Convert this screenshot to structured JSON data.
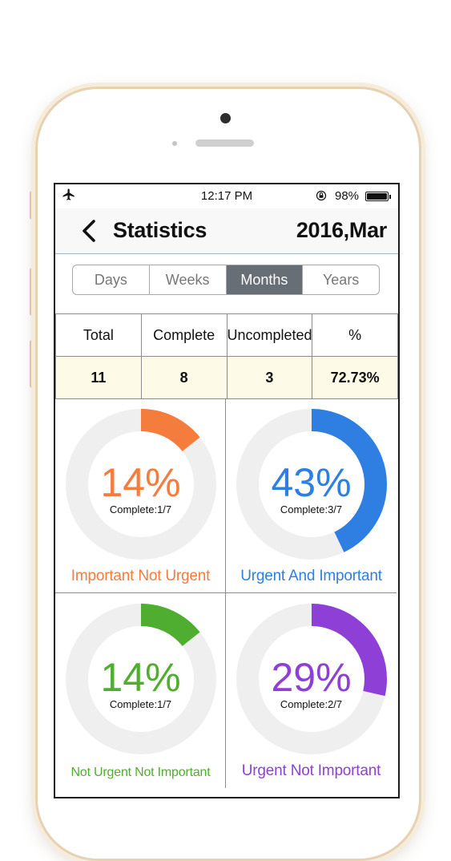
{
  "status_bar": {
    "time": "12:17 PM",
    "battery": "98%",
    "icons": [
      "airplane-icon",
      "orientation-lock-icon",
      "battery-icon"
    ]
  },
  "nav": {
    "back_icon": "chevron-left-icon",
    "title": "Statistics",
    "date": "2016,Mar"
  },
  "tabs": [
    {
      "label": "Days",
      "active": false
    },
    {
      "label": "Weeks",
      "active": false
    },
    {
      "label": "Months",
      "active": true
    },
    {
      "label": "Years",
      "active": false
    }
  ],
  "summary": {
    "headers": [
      "Total",
      "Complete",
      "Uncompleted",
      "%"
    ],
    "values": [
      "11",
      "8",
      "3",
      "72.73%"
    ]
  },
  "quadrants": [
    {
      "percent_text": "14%",
      "fraction": 0.143,
      "complete": "Complete:1/7",
      "label": "Important Not Urgent",
      "color": "#f47c3c"
    },
    {
      "percent_text": "43%",
      "fraction": 0.429,
      "complete": "Complete:3/7",
      "label": "Urgent And Important",
      "color": "#2f7fe2"
    },
    {
      "percent_text": "14%",
      "fraction": 0.143,
      "complete": "Complete:1/7",
      "label": "Not Urgent Not Important",
      "color": "#4fae2f"
    },
    {
      "percent_text": "29%",
      "fraction": 0.286,
      "complete": "Complete:2/7",
      "label": "Urgent Not Important",
      "color": "#8e3fd6"
    }
  ],
  "colors": {
    "ring_track": "#efefef",
    "segment_active": "#676e76",
    "summary_values_bg": "#fdfbe8"
  }
}
